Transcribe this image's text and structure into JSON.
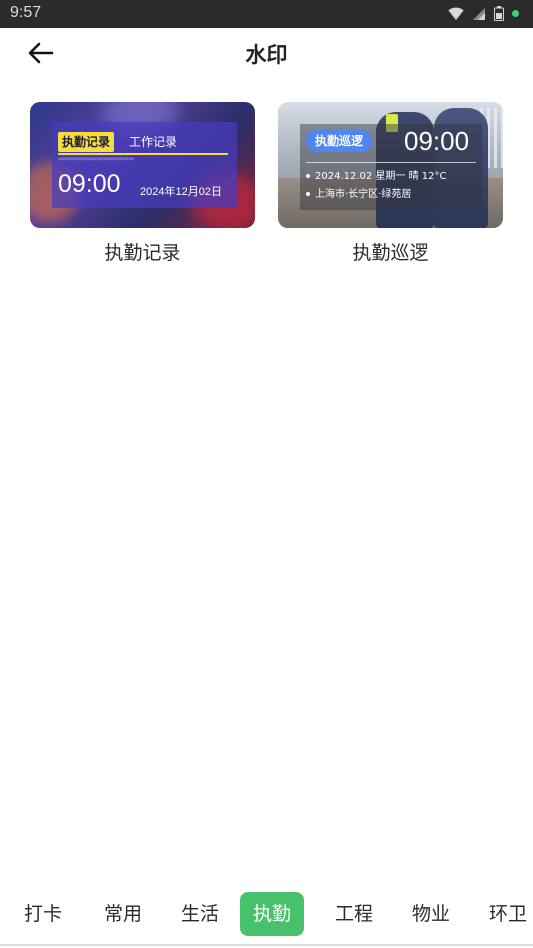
{
  "status_bar": {
    "time": "9:57",
    "icons": [
      "wifi-icon",
      "signal-icon",
      "battery-icon",
      "notification-dot"
    ]
  },
  "header": {
    "title": "水印",
    "back_icon": "arrow-left-icon"
  },
  "cards": [
    {
      "label": "执勤记录",
      "watermark": {
        "tag": "执勤记录",
        "subtitle": "工作记录",
        "time": "09:00",
        "date": "2024年12月02日"
      }
    },
    {
      "label": "执勤巡逻",
      "watermark": {
        "tag": "执勤巡逻",
        "time": "09:00",
        "line1": "2024.12.02 星期一 晴 12°C",
        "line2": "上海市·长宁区·绿苑居"
      }
    }
  ],
  "tabs": [
    {
      "label": "打卡",
      "active": false
    },
    {
      "label": "常用",
      "active": false
    },
    {
      "label": "生活",
      "active": false
    },
    {
      "label": "执勤",
      "active": true
    },
    {
      "label": "工程",
      "active": false
    },
    {
      "label": "物业",
      "active": false
    },
    {
      "label": "环卫",
      "active": false
    }
  ],
  "colors": {
    "accent": "#47c26a",
    "status_bar": "#2b2b2b",
    "tag_yellow": "#f7dd3a",
    "tag_blue": "#4f86ef"
  }
}
